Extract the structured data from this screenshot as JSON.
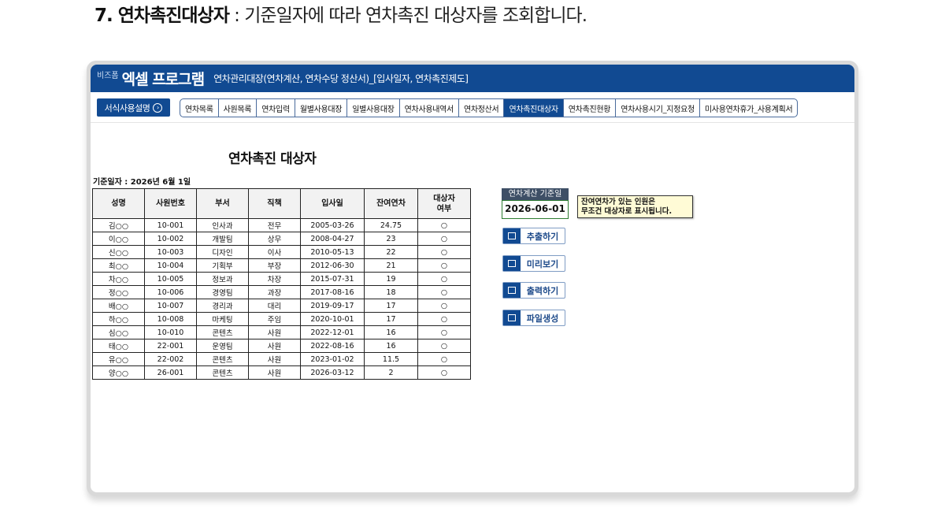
{
  "heading": {
    "bold": "7. 연차촉진대상자",
    "rest": " : 기준일자에 따라 연차촉진 대상자를 조회합니다."
  },
  "header": {
    "brand_small": "비즈폼",
    "brand": "엑셀 프로그램",
    "subtitle": "연차관리대장(연차계산, 연차수당 정산서)_[입사일자, 연차촉진제도]"
  },
  "guide_button": "서식사용설명",
  "guide_icon": "chevron-right-circle-icon",
  "tabs": [
    "연차목록",
    "사원목록",
    "연차입력",
    "월별사용대장",
    "일별사용대장",
    "연차사용내역서",
    "연차정산서",
    "연차촉진대상자",
    "연차촉진현황",
    "연차사용시기_지정요청",
    "미사용연차휴가_사용계획서"
  ],
  "active_tab": "연차촉진대상자",
  "sheet": {
    "title": "연차촉진 대상자",
    "ref_date": "기준일자 : 2026년 6월 1일",
    "columns": [
      "성명",
      "사원번호",
      "부서",
      "직책",
      "입사일",
      "잔여연차",
      "대상자\n여부"
    ],
    "rows": [
      [
        "김○○",
        "10-001",
        "인사과",
        "전무",
        "2005-03-26",
        "24.75",
        "○"
      ],
      [
        "이○○",
        "10-002",
        "개발팀",
        "상무",
        "2008-04-27",
        "23",
        "○"
      ],
      [
        "신○○",
        "10-003",
        "디자인",
        "이사",
        "2010-05-13",
        "22",
        "○"
      ],
      [
        "최○○",
        "10-004",
        "기획부",
        "부장",
        "2012-06-30",
        "21",
        "○"
      ],
      [
        "차○○",
        "10-005",
        "정보과",
        "차장",
        "2015-07-31",
        "19",
        "○"
      ],
      [
        "정○○",
        "10-006",
        "경영팀",
        "과장",
        "2017-08-16",
        "18",
        "○"
      ],
      [
        "배○○",
        "10-007",
        "경리과",
        "대리",
        "2019-09-17",
        "17",
        "○"
      ],
      [
        "하○○",
        "10-008",
        "마케팅",
        "주임",
        "2020-10-01",
        "17",
        "○"
      ],
      [
        "심○○",
        "10-010",
        "콘텐츠",
        "사원",
        "2022-12-01",
        "16",
        "○"
      ],
      [
        "태○○",
        "22-001",
        "운영팀",
        "사원",
        "2022-08-16",
        "16",
        "○"
      ],
      [
        "유○○",
        "22-002",
        "콘텐츠",
        "사원",
        "2023-01-02",
        "11.5",
        "○"
      ],
      [
        "양○○",
        "26-001",
        "콘텐츠",
        "사원",
        "2026-03-12",
        "2",
        "○"
      ]
    ]
  },
  "calc": {
    "label": "연차계산 기준일",
    "value": "2026-06-01",
    "note": "잔여연차가 있는 인원은\n무조건 대상자로 표시됩니다."
  },
  "actions": [
    {
      "label": "추출하기",
      "icon": "copy-icon"
    },
    {
      "label": "미리보기",
      "icon": "monitor-icon"
    },
    {
      "label": "출력하기",
      "icon": "print-icon"
    },
    {
      "label": "파일생성",
      "icon": "folder-icon"
    }
  ]
}
